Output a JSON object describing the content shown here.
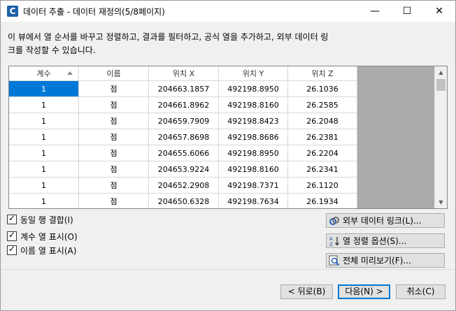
{
  "window": {
    "title": "데이터 추출 - 데이터 재정의(5/8페이지)",
    "app_icon": "C",
    "minimize": "—",
    "maximize": "☐",
    "close": "✕"
  },
  "description": {
    "line1": "이 뷰에서 열 순서를 바꾸고 정렬하고, 결과를 필터하고, 공식 열을 추가하고, 외부 데이터 링",
    "line2": "크를 작성할 수 있습니다."
  },
  "table": {
    "columns": [
      "계수",
      "이름",
      "위치 X",
      "위치 Y",
      "위치 Z"
    ],
    "rows": [
      [
        "1",
        "점",
        "204663.1857",
        "492198.8950",
        "26.1036"
      ],
      [
        "1",
        "점",
        "204661.8962",
        "492198.8160",
        "26.2585"
      ],
      [
        "1",
        "점",
        "204659.7909",
        "492198.8423",
        "26.2048"
      ],
      [
        "1",
        "점",
        "204657.8698",
        "492198.8686",
        "26.2381"
      ],
      [
        "1",
        "점",
        "204655.6066",
        "492198.8950",
        "26.2204"
      ],
      [
        "1",
        "점",
        "204653.9224",
        "492198.8160",
        "26.2341"
      ],
      [
        "1",
        "점",
        "204652.2908",
        "492198.7371",
        "26.1120"
      ],
      [
        "1",
        "점",
        "204650.6328",
        "492198.7634",
        "26.1934"
      ]
    ]
  },
  "options": {
    "combine_rows": "동일 행 결합(I)",
    "show_count": "계수 열 표시(O)",
    "show_name": "이름 열 표시(A)"
  },
  "side_buttons": {
    "link": "외부 데이터 링크(L)...",
    "sort": "열 정렬 옵션(S)...",
    "preview": "전체 미리보기(F)..."
  },
  "footer": {
    "back": "< 뒤로(B)",
    "next": "다음(N) >",
    "cancel": "취소(C)"
  },
  "colors": {
    "selection": "#0078d7",
    "unused_area": "#ababab"
  }
}
